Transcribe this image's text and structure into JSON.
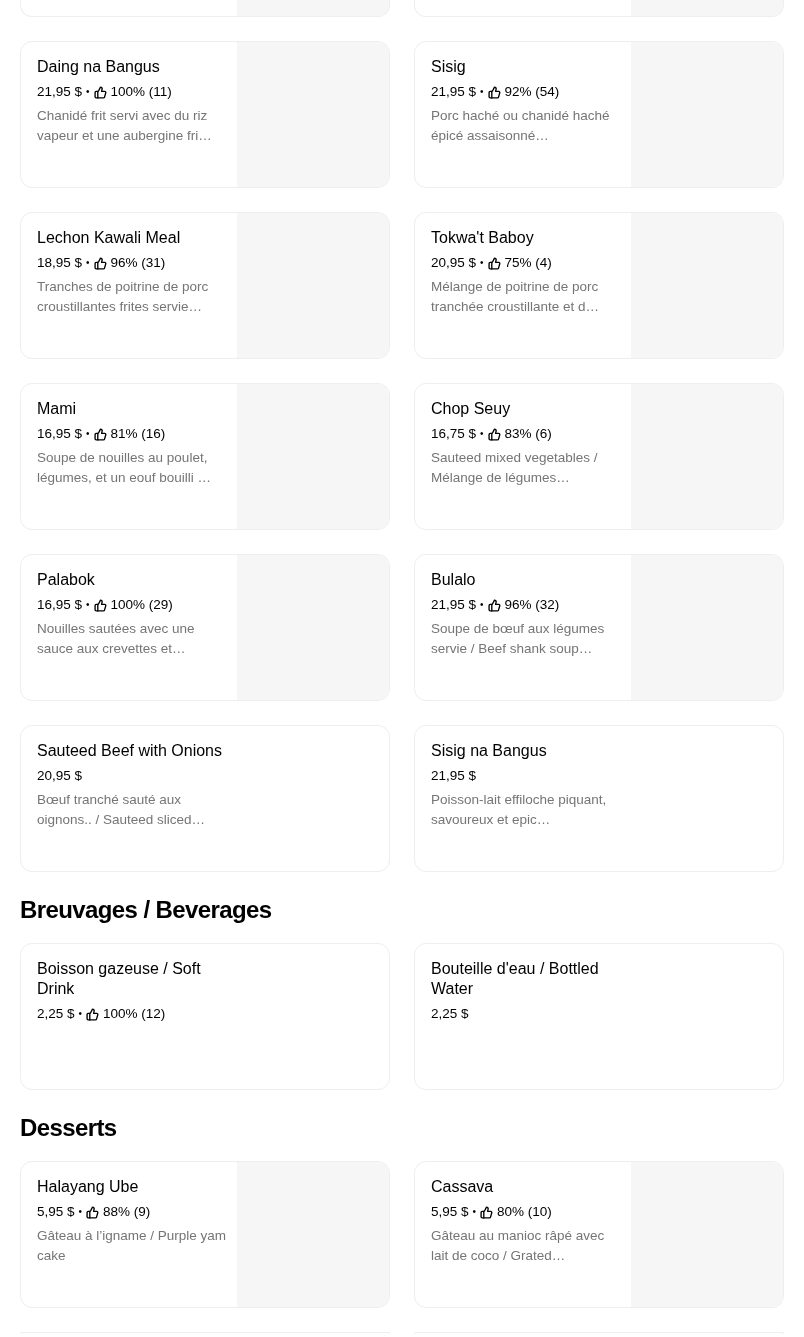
{
  "sections": [
    {
      "items": [
        {
          "kind": "clipped_top_with_picture"
        },
        {
          "kind": "clipped_top_with_picture"
        },
        {
          "kind": "item_with_picture",
          "name": "Daing na Bangus",
          "price": "21,95 $",
          "separator": "•",
          "rating": "100% (11)",
          "description": "Chanidé frit servi avec du riz vapeur et une aubergine fri…"
        },
        {
          "kind": "item_with_picture",
          "name": "Sisig",
          "price": "21,95 $",
          "separator": "•",
          "rating": "92% (54)",
          "description": "Porc haché ou chanidé haché épicé assaisonné…"
        },
        {
          "kind": "item_with_picture",
          "name": "Lechon Kawali Meal",
          "price": "18,95 $",
          "separator": "•",
          "rating": "96% (31)",
          "description": "Tranches de poitrine de porc croustillantes frites servie…"
        },
        {
          "kind": "item_with_picture",
          "name": "Tokwa't Baboy",
          "price": "20,95 $",
          "separator": "•",
          "rating": "75% (4)",
          "description": "Mélange de poitrine de porc tranchée croustillante et d…"
        },
        {
          "kind": "item_with_picture",
          "name": "Mami",
          "price": "16,95 $",
          "separator": "•",
          "rating": "81% (16)",
          "description": "Soupe de nouilles au poulet, légumes, et un eouf bouilli …"
        },
        {
          "kind": "item_with_picture",
          "name": "Chop Seuy",
          "price": "16,75 $",
          "separator": "•",
          "rating": "83% (6)",
          "description": "Sauteed mixed vegetables / Mélange de légumes…"
        },
        {
          "kind": "item_with_picture",
          "name": "Palabok",
          "price": "16,95 $",
          "separator": "•",
          "rating": "100% (29)",
          "description": "Nouilles sautées avec une sauce aux crevettes et…"
        },
        {
          "kind": "item_with_picture",
          "name": "Bulalo",
          "price": "21,95 $",
          "separator": "•",
          "rating": "96% (32)",
          "description": "Soupe de bœuf aux légumes servie / Beef shank soup…"
        },
        {
          "kind": "item",
          "name": "Sauteed Beef with Onions",
          "price": "20,95 $",
          "description": "Bœuf tranché sauté aux oignons.. / Sauteed sliced…"
        },
        {
          "kind": "item",
          "name": "Sisig na Bangus",
          "price": "21,95 $",
          "description": "Poisson-lait effiloche piquant, savoureux et epic…"
        }
      ]
    },
    {
      "title": "Breuvages / Beverages",
      "items": [
        {
          "kind": "item",
          "name": "Boisson gazeuse / Soft Drink",
          "price": "2,25 $",
          "separator": "•",
          "rating": "100% (12)"
        },
        {
          "kind": "item",
          "name": "Bouteille d'eau / Bottled Water",
          "price": "2,25 $"
        }
      ]
    },
    {
      "title": "Desserts",
      "items": [
        {
          "kind": "item_with_picture",
          "name": "Halayang Ube",
          "price": "5,95 $",
          "separator": "•",
          "rating": "88% (9)",
          "description": "Gâteau à l’igname / Purple yam cake"
        },
        {
          "kind": "item_with_picture",
          "name": "Cassava",
          "price": "5,95 $",
          "separator": "•",
          "rating": "80% (10)",
          "description": "Gâteau au manioc râpé avec lait de coco / Grated…"
        },
        {
          "kind": "clipped_bottom"
        },
        {
          "kind": "clipped_bottom"
        }
      ]
    }
  ]
}
